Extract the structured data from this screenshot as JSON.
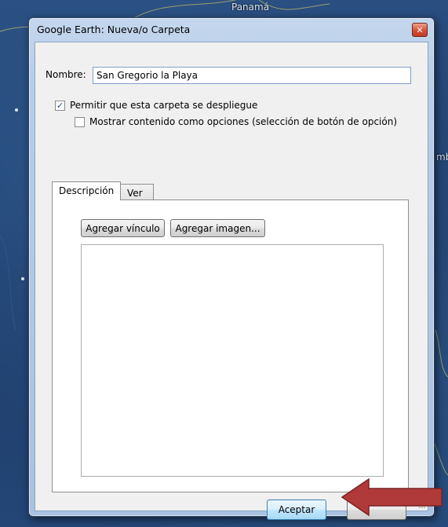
{
  "background": {
    "map_label_top": "Panamá",
    "map_label_right": "mb"
  },
  "dialog": {
    "title": "Google Earth: Nueva/o Carpeta",
    "close_symbol": "✕",
    "name_label": "Nombre:",
    "name_value": "San Gregorio la Playa",
    "checkbox_expand": {
      "label": "Permitir que esta carpeta se despliegue",
      "checked": true
    },
    "checkbox_radio": {
      "label": "Mostrar contenido como opciones (selección de botón de opción)",
      "checked": false
    },
    "tabs": [
      {
        "label": "Descripción",
        "active": true
      },
      {
        "label": "Ver",
        "active": false
      }
    ],
    "add_link_button": "Agregar vínculo",
    "add_image_button": "Agregar imagen...",
    "description_text": "",
    "ok_button": "Aceptar"
  },
  "annotation": {
    "arrow_color": "#b03a3a",
    "icon": "red-arrow-icon"
  },
  "colors": {
    "titlebar": "#b7cde8",
    "ok_button_accent": "#3c7fb1"
  }
}
